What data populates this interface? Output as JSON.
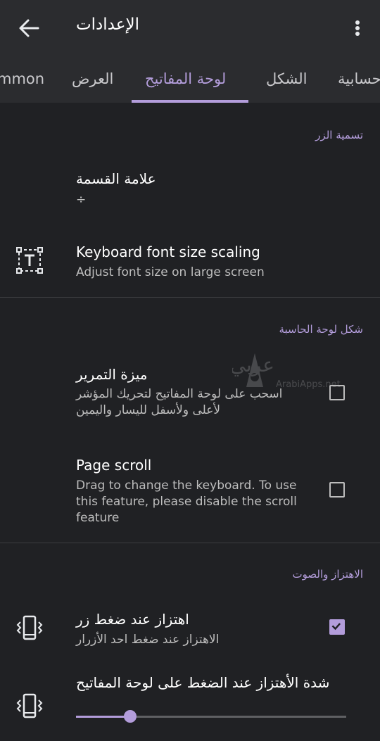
{
  "appbar": {
    "title": "الإعدادات",
    "back_icon": "arrow-back-icon",
    "more_icon": "more-vert-icon"
  },
  "tabs": [
    {
      "label": "mmon",
      "active": false
    },
    {
      "label": "العرض",
      "active": false
    },
    {
      "label": "لوحة المفاتيح",
      "active": true
    },
    {
      "label": "الشكل",
      "active": false
    },
    {
      "label": "حسابية",
      "active": false
    }
  ],
  "sections": {
    "button_label": {
      "title": "تسمية الزر",
      "division": {
        "title": "علامة القسمة",
        "value": "÷"
      },
      "font_scaling": {
        "title": "Keyboard font size scaling",
        "subtitle": "Adjust font size on large screen",
        "icon": "text-size-icon"
      }
    },
    "calculator_shape": {
      "title": "شكل لوحة الحاسبة",
      "scroll_feature": {
        "title": "ميزة التمرير",
        "subtitle": "اسحب على لوحة المفاتيح لتحريك المؤشر لأعلى ولأسفل لليسار واليمين",
        "checked": false
      },
      "page_scroll": {
        "title": "Page scroll",
        "subtitle": "Drag to change the keyboard. To use this feature, please disable the scroll feature",
        "checked": false
      }
    },
    "vibration_sound": {
      "title": "الاهتزاز والصوت",
      "vibrate_press": {
        "title": "اهتزاز عند ضغط زر",
        "subtitle": "الاهتزاز عند ضغط احد الأزرار",
        "checked": true,
        "icon": "vibration-icon"
      },
      "vibration_strength": {
        "title": "شدة الأهتزاز عند الضغط على لوحة المفاتيح",
        "value": 0.2,
        "icon": "vibration-icon"
      }
    }
  },
  "watermark": {
    "text": "عربي ابس",
    "sub": "ArabiApps.net"
  },
  "colors": {
    "accent": "#b39ddb",
    "background": "#202124",
    "bar": "#2b2c2f"
  }
}
